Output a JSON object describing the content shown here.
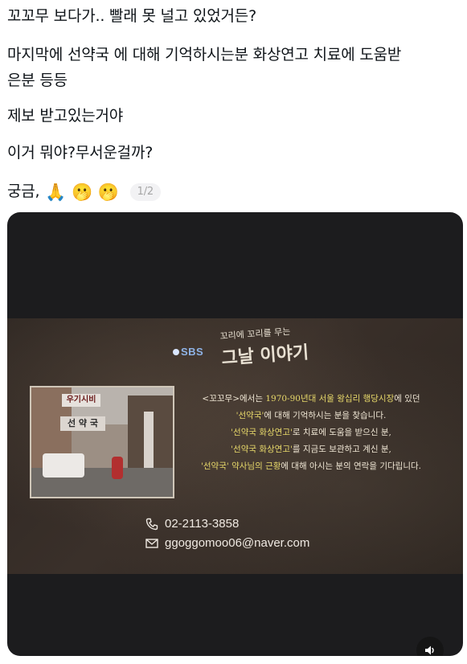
{
  "post": {
    "line1": "꼬꼬무 보다가.. 빨래 못 널고 있었거든?",
    "line2": "마지막에 선약국 에 대해 기억하시는분 화상연고 치료에 도움받",
    "line3": "은분 등등",
    "line4": "제보 받고있는거야",
    "line5": "이거 뭐야?무서운걸까?",
    "line6_text": "궁금,",
    "emojis": [
      "🙏",
      "🫢",
      "🫢"
    ],
    "media_counter": "1/2"
  },
  "video": {
    "logo_text": "SBS",
    "show_title_small": "꼬리에 꼬리를 무는",
    "show_title_big": "그날 이야기",
    "photo_sign_top": "우기시비",
    "photo_sign_main": "선 약 국",
    "caption": {
      "l1_a": "<꼬꼬무>에서는 ",
      "l1_hl": "1970-90년대 서울 왕십리 행당시장",
      "l1_b": "에 있던",
      "l2_hl": "'선약국'",
      "l2_b": "에 대해 기억하시는 분을 찾습니다.",
      "l3_hl": "'선약국 화상연고'",
      "l3_b": "로 치료에 도움을 받으신 분,",
      "l4_hl": "'선약국 화상연고'",
      "l4_b": "를 지금도 보관하고 계신 분,",
      "l5_hl": "'선약국' 약사님의 근황",
      "l5_b": "에 대해 아시는 분의 연락을 기다립니다."
    },
    "phone": "02-2113-3858",
    "email": "ggoggomoo06@naver.com",
    "mute_icon": "speaker-icon"
  }
}
